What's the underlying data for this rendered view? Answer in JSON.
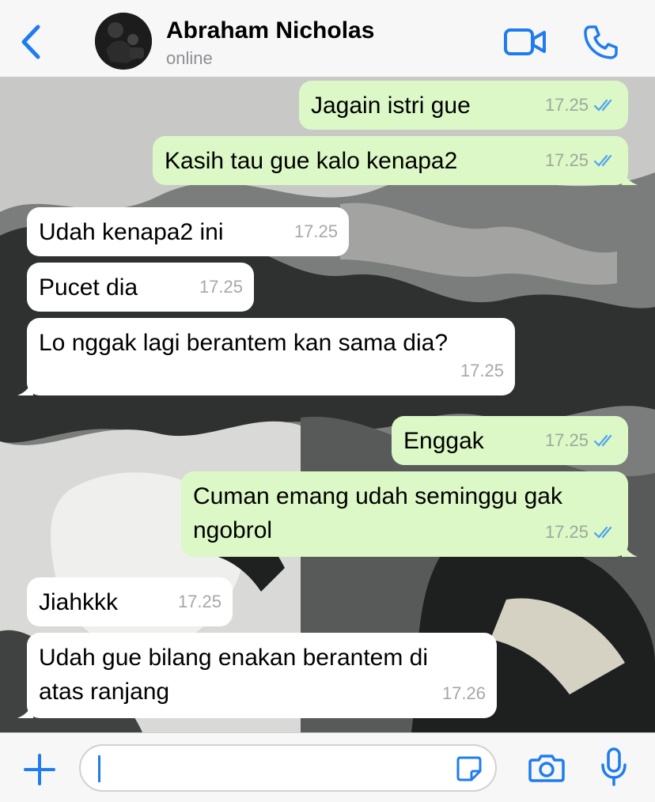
{
  "header": {
    "contact_name": "Abraham Nicholas",
    "status": "online",
    "icons": [
      "chevron-left-icon",
      "avatar",
      "video-call-icon",
      "phone-call-icon"
    ]
  },
  "messages": [
    {
      "direction": "outgoing",
      "text": "Jagain istri gue",
      "time": "17.25",
      "read": true
    },
    {
      "direction": "outgoing",
      "text": "Kasih tau gue kalo kenapa2",
      "time": "17.25",
      "read": true
    },
    {
      "direction": "incoming",
      "text": "Udah kenapa2 ini",
      "time": "17.25"
    },
    {
      "direction": "incoming",
      "text": "Pucet dia",
      "time": "17.25"
    },
    {
      "direction": "incoming",
      "text": "Lo nggak lagi berantem kan sama dia?",
      "time": "17.25"
    },
    {
      "direction": "outgoing",
      "text": "Enggak",
      "time": "17.25",
      "read": true
    },
    {
      "direction": "outgoing",
      "text": "Cuman emang udah seminggu gak\nngobrol",
      "time": "17.25",
      "read": true
    },
    {
      "direction": "incoming",
      "text": "Jiahkkk",
      "time": "17.25"
    },
    {
      "direction": "incoming",
      "text": "Udah gue bilang enakan berantem di\natas ranjang",
      "time": "17.26"
    }
  ],
  "composer": {
    "value": "",
    "icons": [
      "plus-icon",
      "sticker-icon",
      "camera-icon",
      "microphone-icon"
    ]
  },
  "colors": {
    "accent": "#1f7cf0",
    "outgoing_bubble": "#dcf8c6",
    "incoming_bubble": "#ffffff",
    "read_ticks": "#4fa3f0"
  }
}
